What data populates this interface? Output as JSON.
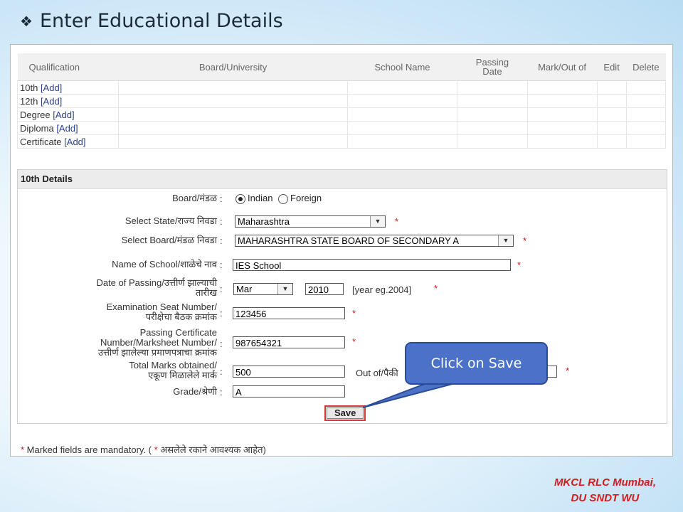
{
  "slide_title": "Enter Educational Details",
  "table": {
    "headers": [
      "Qualification",
      "Board/University",
      "School Name",
      "Passing Date",
      "Mark/Out of",
      "Edit",
      "Delete"
    ],
    "rows": [
      {
        "name": "10th",
        "link": "[Add]"
      },
      {
        "name": "12th",
        "link": "[Add]"
      },
      {
        "name": "Degree",
        "link": "[Add]"
      },
      {
        "name": "Diploma",
        "link": "[Add]"
      },
      {
        "name": "Certificate",
        "link": "[Add]"
      }
    ]
  },
  "details": {
    "header": "10th Details",
    "board_label": "Board/मंडळ",
    "board_options": [
      "Indian",
      "Foreign"
    ],
    "board_selected": "Indian",
    "state_label": "Select State/राज्य निवडा",
    "state_value": "Maharashtra",
    "board_select_label": "Select Board/मंडळ निवडा",
    "board_select_value": "MAHARASHTRA STATE BOARD OF SECONDARY A",
    "school_label": "Name of School/शाळेचे नाव",
    "school_value": "IES School",
    "passing_label_1": "Date of Passing/उत्तीर्ण झाल्याची",
    "passing_label_2": "तारीख",
    "passing_month": "Mar",
    "passing_year": "2010",
    "passing_hint": "[year eg.2004]",
    "seat_label_1": "Examination Seat Number/",
    "seat_label_2": "परीक्षेचा बैठक क्रमांक",
    "seat_value": "123456",
    "cert_label_1": "Passing Certificate",
    "cert_label_2": "Number/Marksheet Number/",
    "cert_label_3": "उत्तीर्ण झालेल्या प्रमाणपत्राचा क्रमांक",
    "cert_value": "987654321",
    "marks_label_1": "Total Marks obtained/",
    "marks_label_2": "एकूण मिळालेले मार्क",
    "marks_value": "500",
    "outof_label": "Out of/पैकी",
    "grade_label": "Grade/श्रेणी",
    "grade_value": "A",
    "save_label": "Save"
  },
  "footnote_star": "*",
  "footnote_text": " Marked fields are mandatory. ( ",
  "footnote_text_2": " असलेले रकाने आवश्यक आहेत)",
  "callout_text": "Click on Save",
  "credit_line_1": "MKCL RLC Mumbai,",
  "credit_line_2": "DU SNDT WU",
  "colors": {
    "callout": "#4c72c8",
    "required": "#d01616",
    "credit": "#d41c1c",
    "link": "#2c3f8f"
  }
}
